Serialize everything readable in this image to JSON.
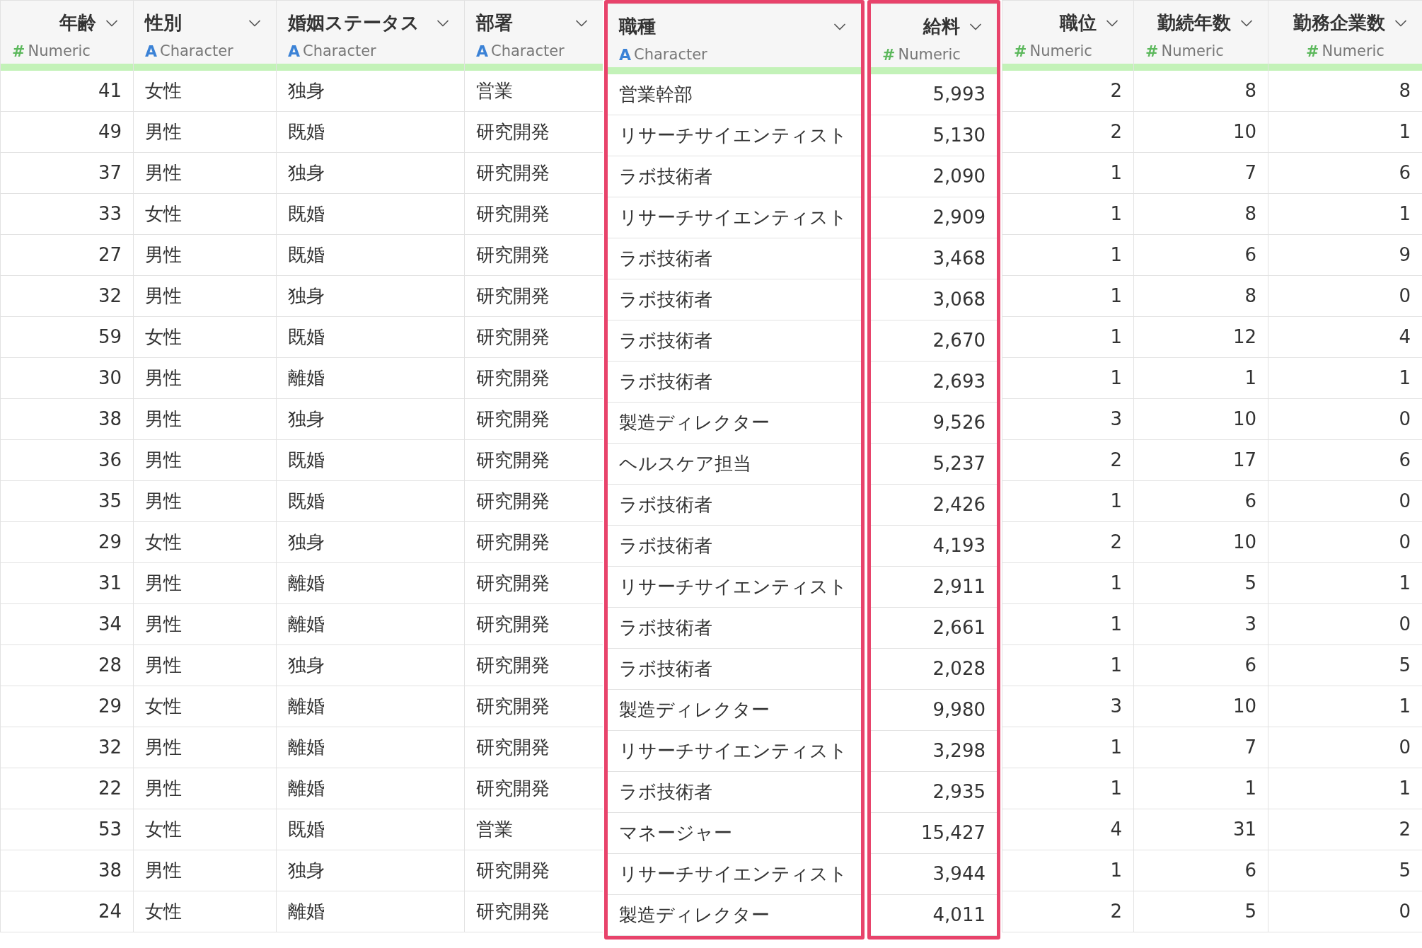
{
  "columns": [
    {
      "title": "年齢",
      "kind": "numeric",
      "type_icon": "#",
      "type": "Numeric",
      "highlighted": false
    },
    {
      "title": "性別",
      "kind": "character",
      "type_icon": "A",
      "type": "Character",
      "highlighted": false
    },
    {
      "title": "婚姻ステータス",
      "kind": "character",
      "type_icon": "A",
      "type": "Character",
      "highlighted": false
    },
    {
      "title": "部署",
      "kind": "character",
      "type_icon": "A",
      "type": "Character",
      "highlighted": false
    },
    {
      "title": "職種",
      "kind": "character",
      "type_icon": "A",
      "type": "Character",
      "highlighted": true
    },
    {
      "title": "給料",
      "kind": "numeric",
      "type_icon": "#",
      "type": "Numeric",
      "highlighted": true
    },
    {
      "title": "職位",
      "kind": "numeric",
      "type_icon": "#",
      "type": "Numeric",
      "highlighted": false
    },
    {
      "title": "勤続年数",
      "kind": "numeric",
      "type_icon": "#",
      "type": "Numeric",
      "highlighted": false
    },
    {
      "title": "勤務企業数",
      "kind": "numeric",
      "type_icon": "#",
      "type": "Numeric",
      "highlighted": false
    }
  ],
  "rows": [
    [
      "41",
      "女性",
      "独身",
      "営業",
      "営業幹部",
      "5,993",
      "2",
      "8",
      "8"
    ],
    [
      "49",
      "男性",
      "既婚",
      "研究開発",
      "リサーチサイエンティスト",
      "5,130",
      "2",
      "10",
      "1"
    ],
    [
      "37",
      "男性",
      "独身",
      "研究開発",
      "ラボ技術者",
      "2,090",
      "1",
      "7",
      "6"
    ],
    [
      "33",
      "女性",
      "既婚",
      "研究開発",
      "リサーチサイエンティスト",
      "2,909",
      "1",
      "8",
      "1"
    ],
    [
      "27",
      "男性",
      "既婚",
      "研究開発",
      "ラボ技術者",
      "3,468",
      "1",
      "6",
      "9"
    ],
    [
      "32",
      "男性",
      "独身",
      "研究開発",
      "ラボ技術者",
      "3,068",
      "1",
      "8",
      "0"
    ],
    [
      "59",
      "女性",
      "既婚",
      "研究開発",
      "ラボ技術者",
      "2,670",
      "1",
      "12",
      "4"
    ],
    [
      "30",
      "男性",
      "離婚",
      "研究開発",
      "ラボ技術者",
      "2,693",
      "1",
      "1",
      "1"
    ],
    [
      "38",
      "男性",
      "独身",
      "研究開発",
      "製造ディレクター",
      "9,526",
      "3",
      "10",
      "0"
    ],
    [
      "36",
      "男性",
      "既婚",
      "研究開発",
      "ヘルスケア担当",
      "5,237",
      "2",
      "17",
      "6"
    ],
    [
      "35",
      "男性",
      "既婚",
      "研究開発",
      "ラボ技術者",
      "2,426",
      "1",
      "6",
      "0"
    ],
    [
      "29",
      "女性",
      "独身",
      "研究開発",
      "ラボ技術者",
      "4,193",
      "2",
      "10",
      "0"
    ],
    [
      "31",
      "男性",
      "離婚",
      "研究開発",
      "リサーチサイエンティスト",
      "2,911",
      "1",
      "5",
      "1"
    ],
    [
      "34",
      "男性",
      "離婚",
      "研究開発",
      "ラボ技術者",
      "2,661",
      "1",
      "3",
      "0"
    ],
    [
      "28",
      "男性",
      "独身",
      "研究開発",
      "ラボ技術者",
      "2,028",
      "1",
      "6",
      "5"
    ],
    [
      "29",
      "女性",
      "離婚",
      "研究開発",
      "製造ディレクター",
      "9,980",
      "3",
      "10",
      "1"
    ],
    [
      "32",
      "男性",
      "離婚",
      "研究開発",
      "リサーチサイエンティスト",
      "3,298",
      "1",
      "7",
      "0"
    ],
    [
      "22",
      "男性",
      "離婚",
      "研究開発",
      "ラボ技術者",
      "2,935",
      "1",
      "1",
      "1"
    ],
    [
      "53",
      "女性",
      "既婚",
      "営業",
      "マネージャー",
      "15,427",
      "4",
      "31",
      "2"
    ],
    [
      "38",
      "男性",
      "独身",
      "研究開発",
      "リサーチサイエンティスト",
      "3,944",
      "1",
      "6",
      "5"
    ],
    [
      "24",
      "女性",
      "離婚",
      "研究開発",
      "製造ディレクター",
      "4,011",
      "2",
      "5",
      "0"
    ]
  ]
}
